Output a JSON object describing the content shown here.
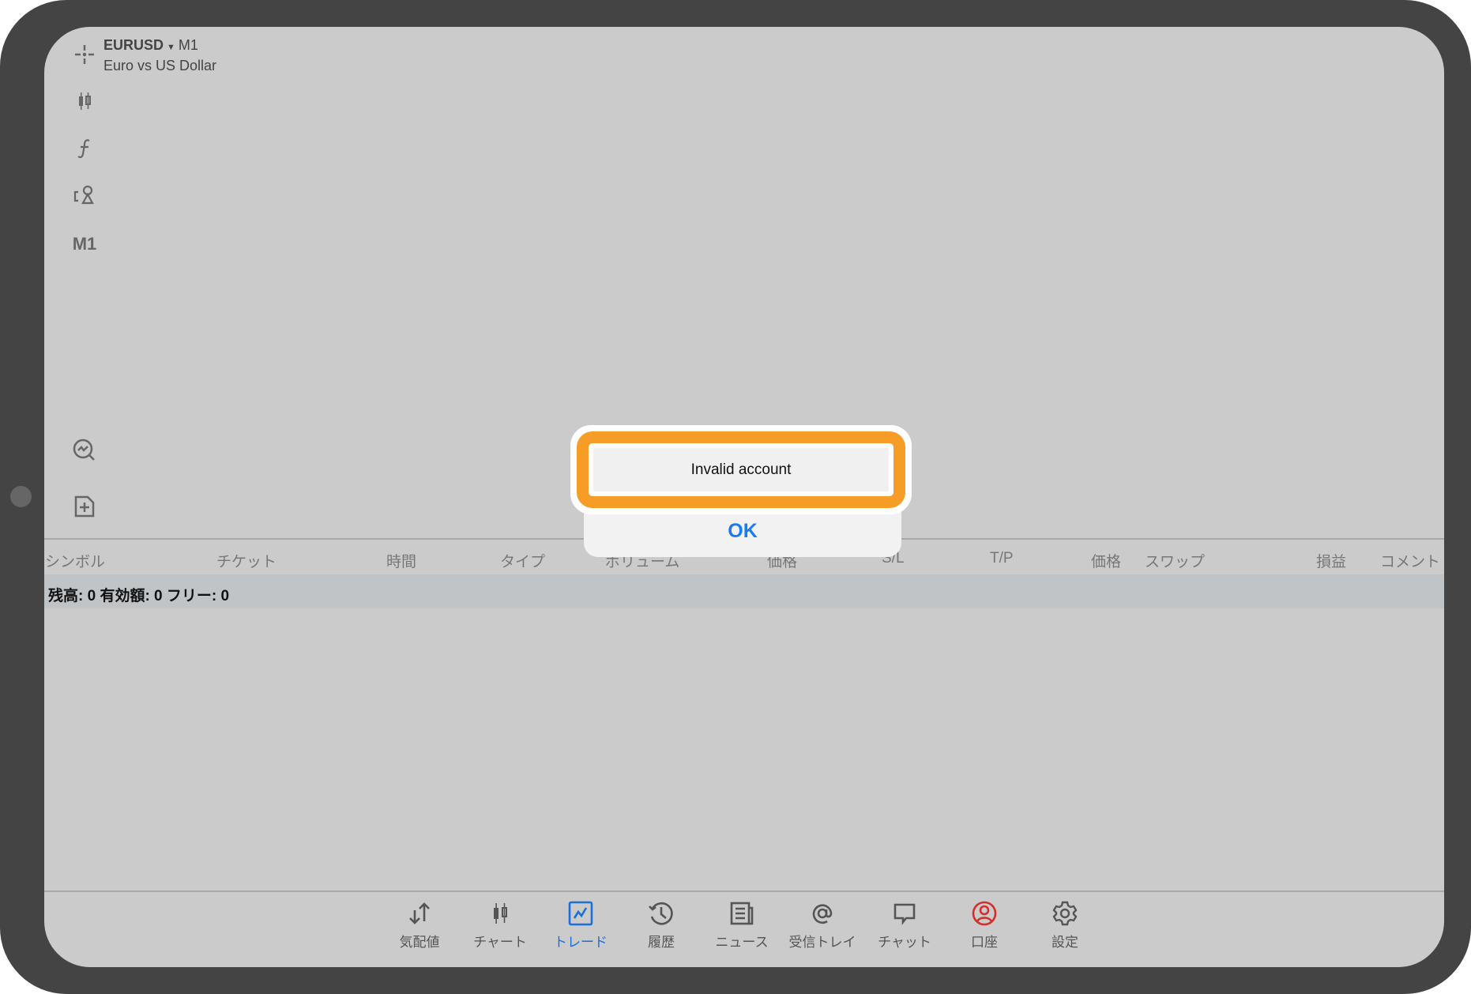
{
  "header": {
    "symbol": "EURUSD",
    "timeframe": "M1",
    "description": "Euro vs US Dollar"
  },
  "sidebar": {
    "timeframe_label": "M1",
    "icons": [
      "crosshair-icon",
      "candlestick-icon",
      "function-icon",
      "objects-icon",
      "timeframe",
      "chart-search-icon",
      "new-order-icon"
    ]
  },
  "table": {
    "columns": [
      "シンボル",
      "チケット",
      "時間",
      "タイプ",
      "ボリューム",
      "価格",
      "S/L",
      "T/P",
      "価格",
      "スワップ",
      "損益",
      "コメント"
    ],
    "balance_row": "残高: 0 有効額: 0 フリー: 0"
  },
  "tabs": [
    {
      "label": "気配値",
      "icon": "quotes-icon"
    },
    {
      "label": "チャート",
      "icon": "chart-icon"
    },
    {
      "label": "トレード",
      "icon": "trade-icon",
      "active": true
    },
    {
      "label": "履歴",
      "icon": "history-icon"
    },
    {
      "label": "ニュース",
      "icon": "news-icon"
    },
    {
      "label": "受信トレイ",
      "icon": "mail-icon"
    },
    {
      "label": "チャット",
      "icon": "chat-icon"
    },
    {
      "label": "口座",
      "icon": "account-icon"
    },
    {
      "label": "設定",
      "icon": "settings-icon"
    }
  ],
  "dialog": {
    "message": "Invalid account",
    "ok_label": "OK"
  },
  "colors": {
    "accent": "#1a6fd9",
    "highlight": "#f59d27",
    "account": "#d2302a"
  }
}
